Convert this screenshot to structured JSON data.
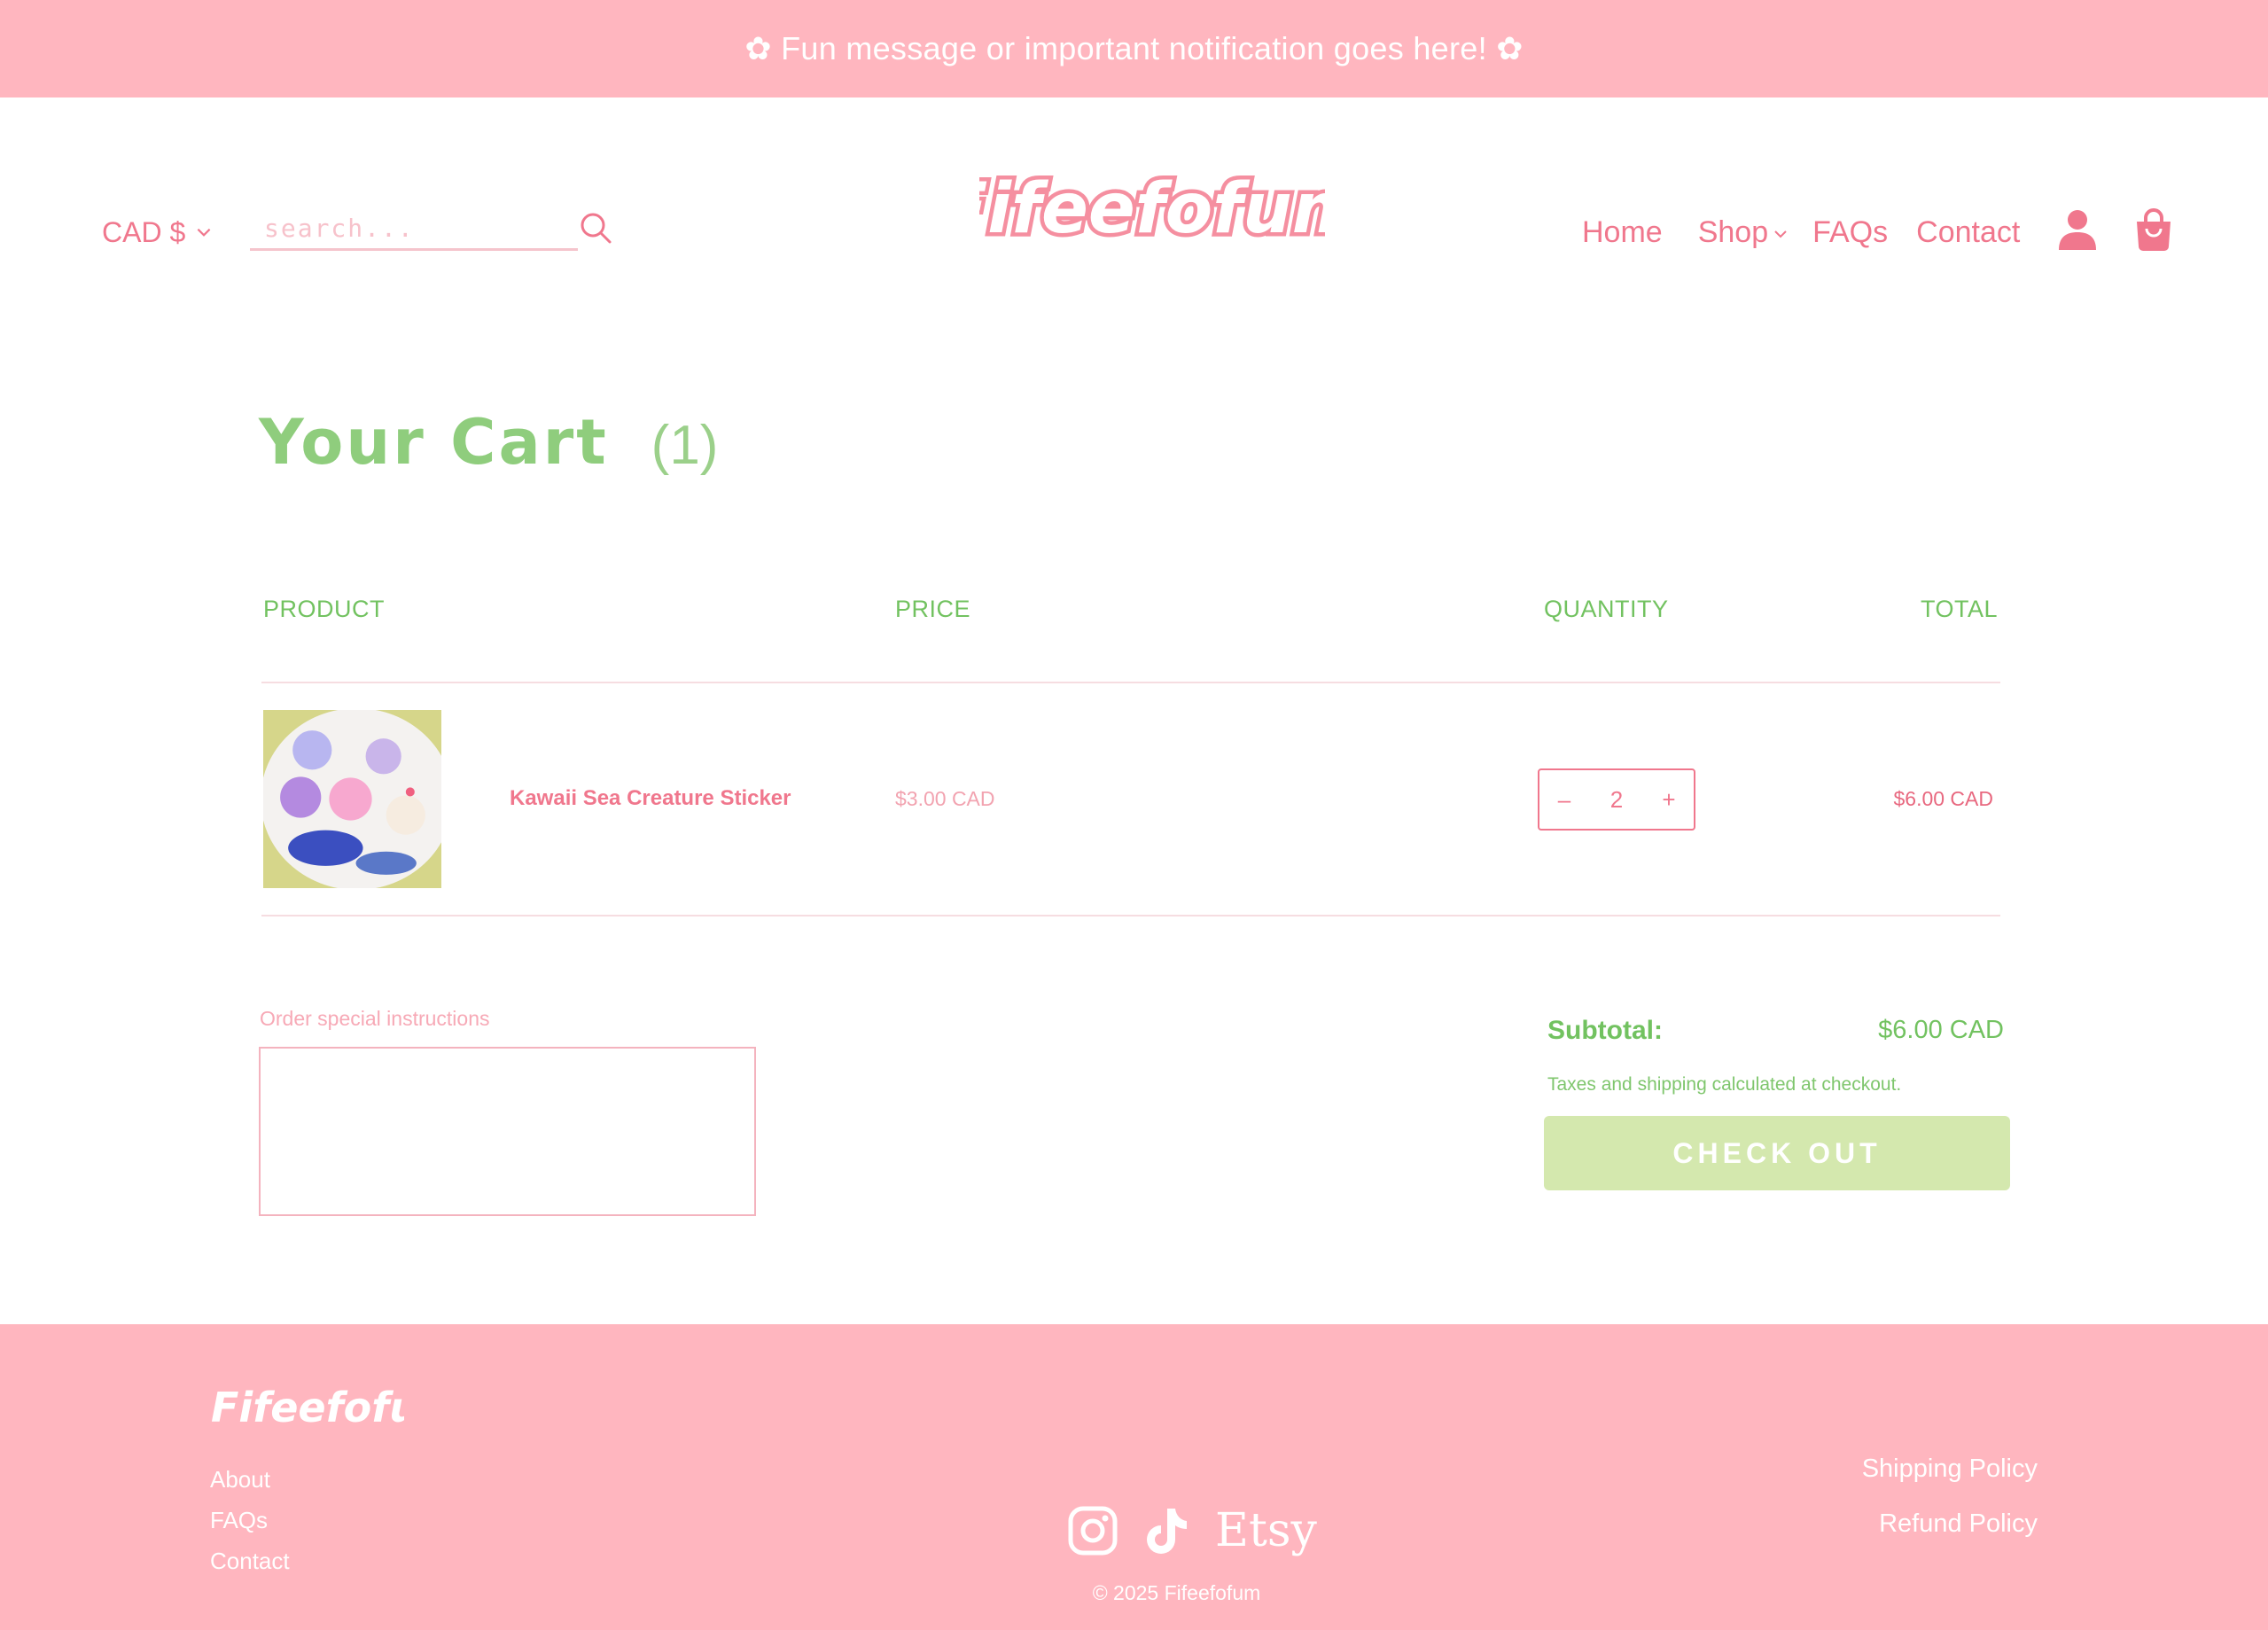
{
  "announcement": "✿ Fun message or important notification goes here! ✿",
  "header": {
    "currency": "CAD $",
    "search_placeholder": "search...",
    "logo_text": "Fifeefofum",
    "nav": {
      "home": "Home",
      "shop": "Shop",
      "faqs": "FAQs",
      "contact": "Contact"
    }
  },
  "cart": {
    "title": "Your Cart",
    "count": "(1)",
    "columns": {
      "product": "PRODUCT",
      "price": "PRICE",
      "quantity": "QUANTITY",
      "total": "TOTAL"
    },
    "items": [
      {
        "name": "Kawaii Sea Creature Sticker",
        "price": "$3.00 CAD",
        "quantity": "2",
        "total": "$6.00 CAD",
        "qty_minus": "–",
        "qty_plus": "+"
      }
    ],
    "notes_label": "Order special instructions",
    "subtotal_label": "Subtotal:",
    "subtotal_value": "$6.00 CAD",
    "tax_note": "Taxes and shipping calculated at checkout.",
    "checkout_label": "CHECK OUT"
  },
  "footer": {
    "logo_text": "Fifeefofum",
    "links": [
      "About",
      "FAQs",
      "Contact"
    ],
    "policies": [
      "Shipping Policy",
      "Refund Policy"
    ],
    "social": {
      "etsy": "Etsy"
    },
    "copyright": "© 2025 Fifeefofum"
  },
  "colors": {
    "pink_bar": "#ffb6bf",
    "pink_text": "#f0778d",
    "green_text": "#72c260",
    "checkout_bg": "#d4e8ae"
  }
}
